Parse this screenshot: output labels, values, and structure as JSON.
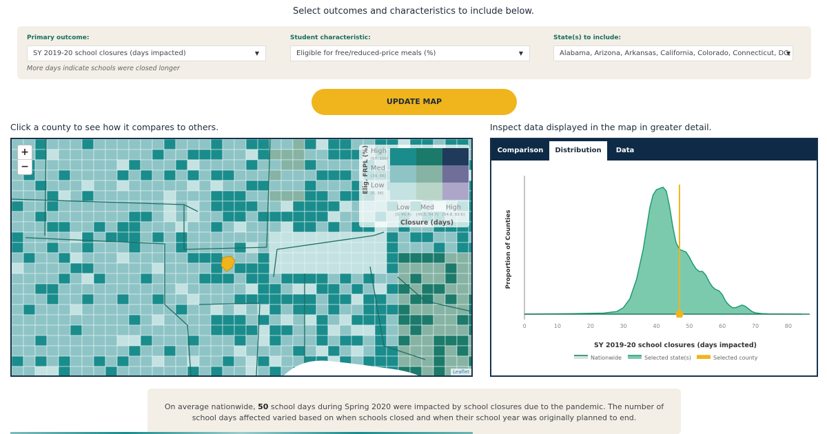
{
  "intro": "Select outcomes and characteristics to include below.",
  "controls": {
    "primary_outcome": {
      "label": "Primary outcome:",
      "value": "SY 2019-20 school closures (days impacted)",
      "hint": "More days indicate schools were closed longer"
    },
    "student_characteristic": {
      "label": "Student characteristic:",
      "value": "Eligible for free/reduced-price meals (%)"
    },
    "states": {
      "label": "State(s) to include:",
      "value": "Alabama, Arizona, Arkansas, California, Colorado, Connecticut, DC, D"
    },
    "caret": "▼"
  },
  "update_button": "UPDATE MAP",
  "map_section": {
    "label": "Click a county to see how it compares to others.",
    "zoom_in": "+",
    "zoom_out": "−",
    "attribution": "Leaflet",
    "legend": {
      "y_title": "Elig. FRPL (%)",
      "x_title": "Closure (days)",
      "rows": [
        {
          "label": "High",
          "range": "[67, 100]"
        },
        {
          "label": "Med",
          "range": "[39, 66]"
        },
        {
          "label": "Low",
          "range": "[0, 38]"
        }
      ],
      "cols": [
        {
          "label": "Low",
          "range": "[0, 45.4]"
        },
        {
          "label": "Med",
          "range": "[45.5, 54.7]"
        },
        {
          "label": "High",
          "range": "[54.8, 83.6]"
        }
      ],
      "colors": [
        [
          "#1a8c8c",
          "#1c7a6a",
          "#1f3a5a"
        ],
        [
          "#8ec4c6",
          "#86b3a3",
          "#6f6f9a"
        ],
        [
          "#c4e2e2",
          "#b8d5c8",
          "#ada6c9"
        ]
      ]
    },
    "selected_county_color": "#f0b51c"
  },
  "detail_section": {
    "label": "Inspect data displayed in the map in greater detail.",
    "tabs": [
      {
        "label": "Comparison",
        "active": false
      },
      {
        "label": "Distribution",
        "active": true
      },
      {
        "label": "Data",
        "active": false
      }
    ]
  },
  "chart_data": {
    "type": "area",
    "title": "",
    "xlabel": "SY 2019-20 school closures (days impacted)",
    "ylabel": "Proportion of Counties",
    "xlim": [
      0,
      84
    ],
    "xticks": [
      0,
      10,
      20,
      30,
      40,
      50,
      60,
      70,
      80
    ],
    "series": [
      {
        "name": "Selected state(s)",
        "color": "#1f9a72",
        "fill": "#7ccaad",
        "x": [
          0,
          14,
          24,
          28,
          30,
          32,
          34,
          36,
          37,
          38,
          39,
          40,
          41,
          42,
          43,
          44,
          45,
          46,
          47,
          48,
          49,
          50,
          51,
          52,
          53,
          54,
          55,
          56,
          57,
          58,
          59,
          60,
          61,
          62,
          63,
          64,
          65,
          66,
          67,
          68,
          69,
          70,
          72,
          74,
          84
        ],
        "y": [
          0,
          0.003,
          0.008,
          0.02,
          0.05,
          0.12,
          0.27,
          0.5,
          0.66,
          0.82,
          0.92,
          0.96,
          0.97,
          0.98,
          0.95,
          0.83,
          0.67,
          0.55,
          0.5,
          0.49,
          0.48,
          0.44,
          0.39,
          0.35,
          0.33,
          0.33,
          0.3,
          0.25,
          0.21,
          0.19,
          0.18,
          0.15,
          0.1,
          0.07,
          0.05,
          0.05,
          0.06,
          0.07,
          0.06,
          0.04,
          0.02,
          0.01,
          0.004,
          0.002,
          0
        ]
      },
      {
        "name": "Nationwide",
        "color": "#1a7a60",
        "style": "line"
      },
      {
        "name": "Selected county",
        "color": "#f0b51c",
        "value": 47
      }
    ],
    "legend": [
      "Nationwide",
      "Selected state(s)",
      "Selected county"
    ],
    "legend_position": "bottom"
  },
  "summary": {
    "prefix": "On average nationwide, ",
    "value": "50",
    "suffix": " school days during Spring 2020 were impacted by school closures due to the pandemic. The number of school days affected varied based on when schools closed and when their school year was originally planned to end."
  }
}
